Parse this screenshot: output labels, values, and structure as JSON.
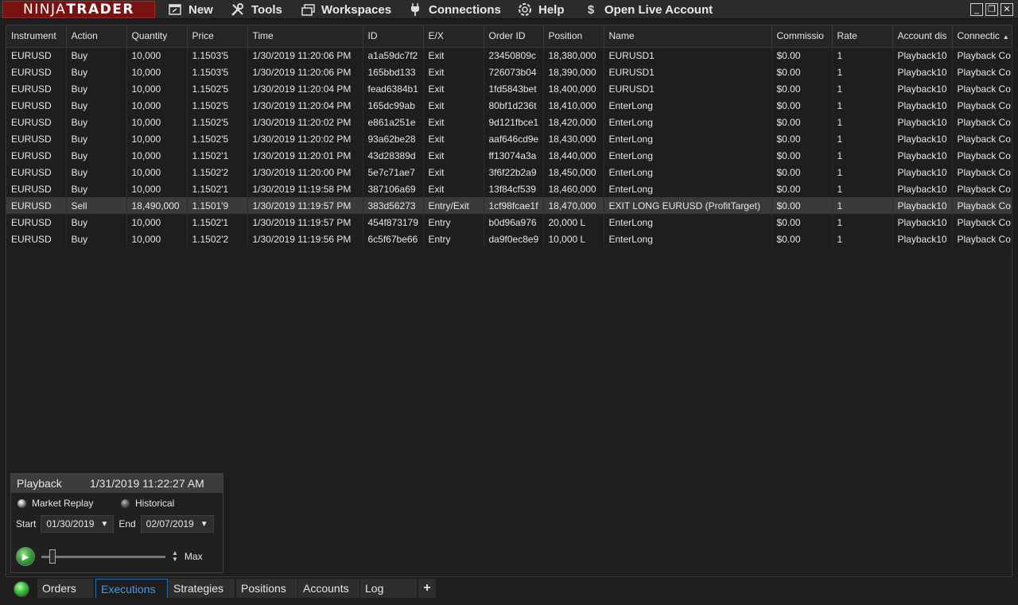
{
  "app": {
    "logo_part1": "NINJA",
    "logo_part2": "TRADER"
  },
  "menu": [
    {
      "label": "New",
      "icon": "new-window-icon"
    },
    {
      "label": "Tools",
      "icon": "tools-icon"
    },
    {
      "label": "Workspaces",
      "icon": "workspaces-icon"
    },
    {
      "label": "Connections",
      "icon": "plug-icon"
    },
    {
      "label": "Help",
      "icon": "help-icon"
    },
    {
      "label": "Open Live Account",
      "icon": "dollar-icon"
    }
  ],
  "grid": {
    "columns": [
      "Instrument",
      "Action",
      "Quantity",
      "Price",
      "Time",
      "ID",
      "E/X",
      "Order ID",
      "Position",
      "Name",
      "Commissio",
      "Rate",
      "Account dis",
      "Connectic"
    ],
    "rows": [
      [
        "EURUSD",
        "Buy",
        "10,000",
        "1.1503'5",
        "1/30/2019 11:20:06 PM",
        "a1a59dc7f2",
        "Exit",
        "23450809c",
        "18,380,000",
        "EURUSD1",
        "$0.00",
        "1",
        "Playback10",
        "Playback Co"
      ],
      [
        "EURUSD",
        "Buy",
        "10,000",
        "1.1503'5",
        "1/30/2019 11:20:06 PM",
        "165bbd133",
        "Exit",
        "726073b04",
        "18,390,000",
        "EURUSD1",
        "$0.00",
        "1",
        "Playback10",
        "Playback Co"
      ],
      [
        "EURUSD",
        "Buy",
        "10,000",
        "1.1502'5",
        "1/30/2019 11:20:04 PM",
        "fead6384b1",
        "Exit",
        "1fd5843bet",
        "18,400,000",
        "EURUSD1",
        "$0.00",
        "1",
        "Playback10",
        "Playback Co"
      ],
      [
        "EURUSD",
        "Buy",
        "10,000",
        "1.1502'5",
        "1/30/2019 11:20:04 PM",
        "165dc99ab",
        "Exit",
        "80bf1d236t",
        "18,410,000",
        "EnterLong",
        "$0.00",
        "1",
        "Playback10",
        "Playback Co"
      ],
      [
        "EURUSD",
        "Buy",
        "10,000",
        "1.1502'5",
        "1/30/2019 11:20:02 PM",
        "e861a251e",
        "Exit",
        "9d121fbce1",
        "18,420,000",
        "EnterLong",
        "$0.00",
        "1",
        "Playback10",
        "Playback Co"
      ],
      [
        "EURUSD",
        "Buy",
        "10,000",
        "1.1502'5",
        "1/30/2019 11:20:02 PM",
        "93a62be28",
        "Exit",
        "aaf646cd9e",
        "18,430,000",
        "EnterLong",
        "$0.00",
        "1",
        "Playback10",
        "Playback Co"
      ],
      [
        "EURUSD",
        "Buy",
        "10,000",
        "1.1502'1",
        "1/30/2019 11:20:01 PM",
        "43d28389d",
        "Exit",
        "ff13074a3a",
        "18,440,000",
        "EnterLong",
        "$0.00",
        "1",
        "Playback10",
        "Playback Co"
      ],
      [
        "EURUSD",
        "Buy",
        "10,000",
        "1.1502'2",
        "1/30/2019 11:20:00 PM",
        "5e7c71ae7",
        "Exit",
        "3f6f22b2a9",
        "18,450,000",
        "EnterLong",
        "$0.00",
        "1",
        "Playback10",
        "Playback Co"
      ],
      [
        "EURUSD",
        "Buy",
        "10,000",
        "1.1502'1",
        "1/30/2019 11:19:58 PM",
        "387106a69",
        "Exit",
        "13f84cf539",
        "18,460,000",
        "EnterLong",
        "$0.00",
        "1",
        "Playback10",
        "Playback Co"
      ],
      [
        "EURUSD",
        "Sell",
        "18,490,000",
        "1.1501'9",
        "1/30/2019 11:19:57 PM",
        "383d56273",
        "Entry/Exit",
        "1cf98fcae1f",
        "18,470,000",
        "EXIT LONG EURUSD (ProfitTarget)",
        "$0.00",
        "1",
        "Playback10",
        "Playback Co"
      ],
      [
        "EURUSD",
        "Buy",
        "10,000",
        "1.1502'1",
        "1/30/2019 11:19:57 PM",
        "454f873179",
        "Entry",
        "b0d96a976",
        "20,000 L",
        "EnterLong",
        "$0.00",
        "1",
        "Playback10",
        "Playback Co"
      ],
      [
        "EURUSD",
        "Buy",
        "10,000",
        "1.1502'2",
        "1/30/2019 11:19:56 PM",
        "6c5f67be66",
        "Entry",
        "da9f0ec8e9",
        "10,000 L",
        "EnterLong",
        "$0.00",
        "1",
        "Playback10",
        "Playback Co"
      ]
    ],
    "selected_row": 9
  },
  "playback": {
    "title": "Playback",
    "datetime": "1/31/2019 11:22:27 AM",
    "mode_market_replay": "Market Replay",
    "mode_historical": "Historical",
    "start_label": "Start",
    "start_value": "01/30/2019",
    "end_label": "End",
    "end_value": "02/07/2019",
    "speed_label": "Max"
  },
  "tabs": [
    {
      "label": "Orders",
      "active": false
    },
    {
      "label": "Executions",
      "active": true
    },
    {
      "label": "Strategies",
      "active": false
    },
    {
      "label": "Positions",
      "active": false
    },
    {
      "label": "Accounts",
      "active": false
    },
    {
      "label": "Log",
      "active": false
    },
    {
      "label": "+",
      "active": false
    }
  ],
  "colors": {
    "accent": "#3d9bef",
    "logo_bg": "#7b1212",
    "connected": "#3cbc3c"
  }
}
